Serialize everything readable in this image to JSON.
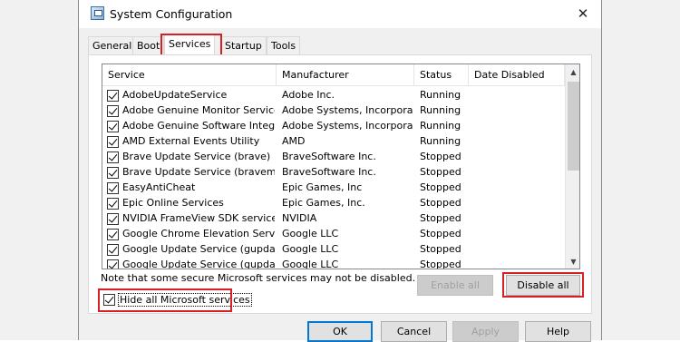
{
  "window": {
    "title": "System Configuration",
    "close_glyph": "✕"
  },
  "tabs": [
    "General",
    "Boot",
    "Services",
    "Startup",
    "Tools"
  ],
  "active_tab": "Services",
  "columns": [
    "Service",
    "Manufacturer",
    "Status",
    "Date Disabled"
  ],
  "services": [
    {
      "name": "AdobeUpdateService",
      "manufacturer": "Adobe Inc.",
      "status": "Running",
      "date_disabled": ""
    },
    {
      "name": "Adobe Genuine Monitor Service",
      "manufacturer": "Adobe Systems, Incorpora...",
      "status": "Running",
      "date_disabled": ""
    },
    {
      "name": "Adobe Genuine Software Integri...",
      "manufacturer": "Adobe Systems, Incorpora...",
      "status": "Running",
      "date_disabled": ""
    },
    {
      "name": "AMD External Events Utility",
      "manufacturer": "AMD",
      "status": "Running",
      "date_disabled": ""
    },
    {
      "name": "Brave Update Service (brave)",
      "manufacturer": "BraveSoftware Inc.",
      "status": "Stopped",
      "date_disabled": ""
    },
    {
      "name": "Brave Update Service (bravem)",
      "manufacturer": "BraveSoftware Inc.",
      "status": "Stopped",
      "date_disabled": ""
    },
    {
      "name": "EasyAntiCheat",
      "manufacturer": "Epic Games, Inc",
      "status": "Stopped",
      "date_disabled": ""
    },
    {
      "name": "Epic Online Services",
      "manufacturer": "Epic Games, Inc.",
      "status": "Stopped",
      "date_disabled": ""
    },
    {
      "name": "NVIDIA FrameView SDK service",
      "manufacturer": "NVIDIA",
      "status": "Stopped",
      "date_disabled": ""
    },
    {
      "name": "Google Chrome Elevation Servic...",
      "manufacturer": "Google LLC",
      "status": "Stopped",
      "date_disabled": ""
    },
    {
      "name": "Google Update Service (gupdate)",
      "manufacturer": "Google LLC",
      "status": "Stopped",
      "date_disabled": ""
    },
    {
      "name": "Google Update Service (gupdatem)",
      "manufacturer": "Google LLC",
      "status": "Stopped",
      "date_disabled": ""
    }
  ],
  "note": "Note that some secure Microsoft services may not be disabled.",
  "buttons": {
    "enable_all": "Enable all",
    "disable_all": "Disable all",
    "ok": "OK",
    "cancel": "Cancel",
    "apply": "Apply",
    "help": "Help"
  },
  "hide_ms": {
    "label": "Hide all Microsoft services",
    "checked": true
  },
  "colors": {
    "highlight_red": "#d91f26",
    "focus_blue": "#0078d7"
  }
}
